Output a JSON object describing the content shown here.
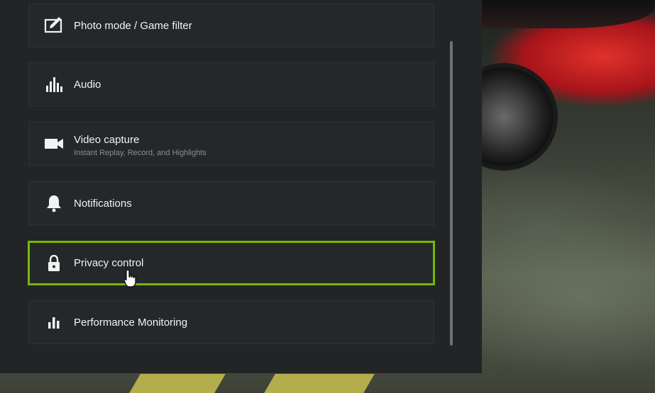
{
  "settings_menu": {
    "items": [
      {
        "label": "Photo mode / Game filter",
        "icon": "photo-edit-icon"
      },
      {
        "label": "Audio",
        "icon": "audio-equalizer-icon"
      },
      {
        "label": "Video capture",
        "sublabel": "Instant Replay, Record, and Highlights",
        "icon": "video-camera-icon"
      },
      {
        "label": "Notifications",
        "icon": "bell-icon"
      },
      {
        "label": "Privacy control",
        "icon": "lock-icon",
        "selected": true
      },
      {
        "label": "Performance Monitoring",
        "icon": "bar-chart-icon"
      }
    ]
  },
  "colors": {
    "panel_bg": "#222426",
    "item_bg": "#25282a",
    "selected_border": "#76b900",
    "text": "#f2f2f2",
    "subtext": "#8c8f92"
  }
}
